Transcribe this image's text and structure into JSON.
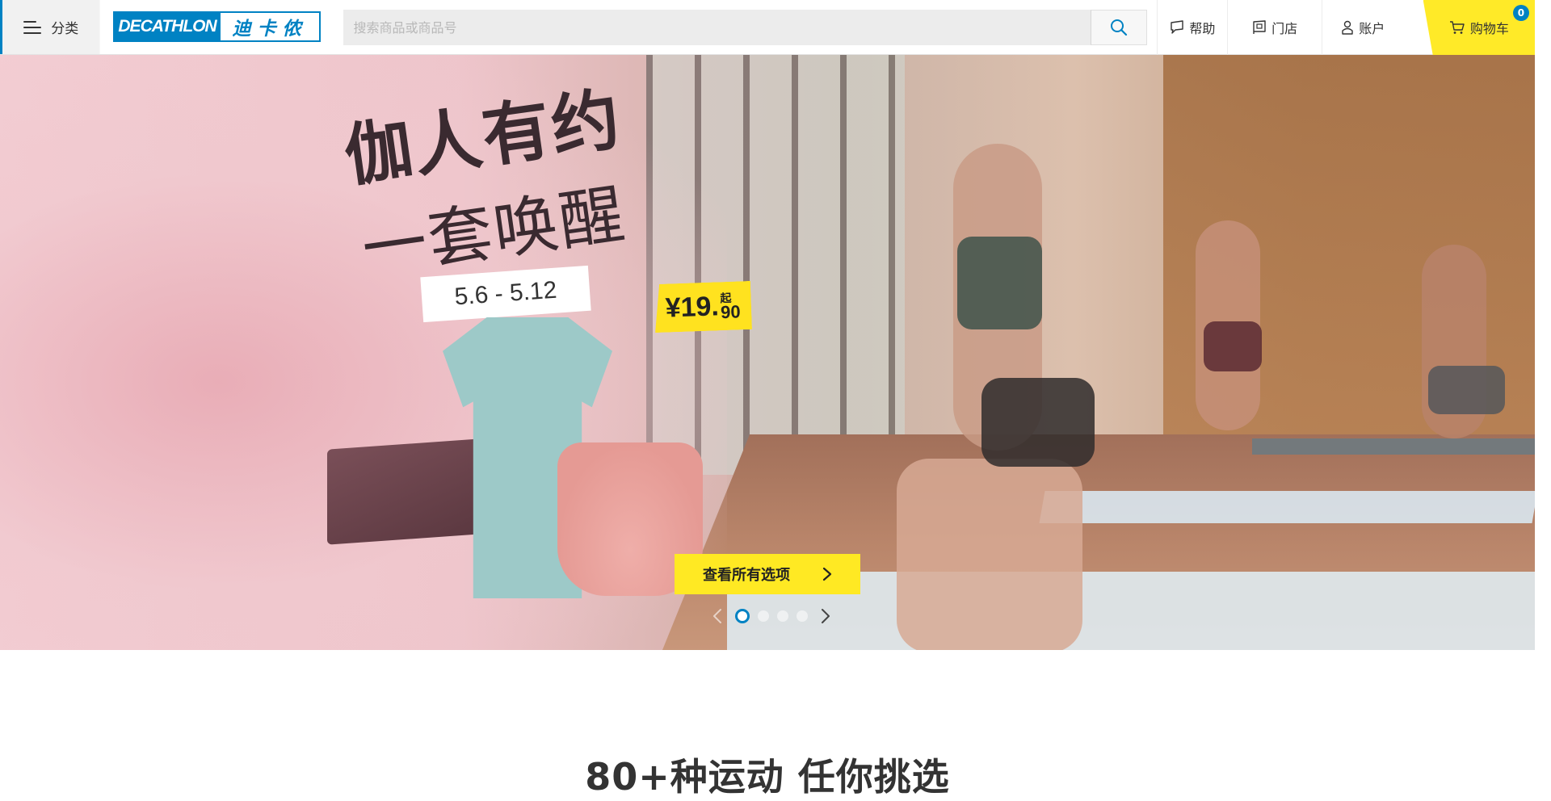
{
  "header": {
    "menu_label": "分类",
    "logo_en": "DECATHLON",
    "logo_cn": "迪卡侬",
    "search": {
      "placeholder": "搜索商品或商品号",
      "value": ""
    },
    "nav": {
      "help": "帮助",
      "store": "门店",
      "account": "账户",
      "cart": "购物车",
      "cart_count": "0"
    }
  },
  "hero": {
    "headline_line1": "伽人有约",
    "headline_line2": "一套唤醒",
    "date_range": "5.6 - 5.12",
    "price_main": "¥19.",
    "price_qi": "起",
    "price_cents": "90",
    "cta_label": "查看所有选项",
    "slides_count": 4,
    "active_slide": 1
  },
  "section": {
    "title": "80+种运动 任你挑选"
  },
  "colors": {
    "brand_blue": "#0082c3",
    "cart_yellow": "#ffea28",
    "cta_yellow": "#ffe923"
  }
}
